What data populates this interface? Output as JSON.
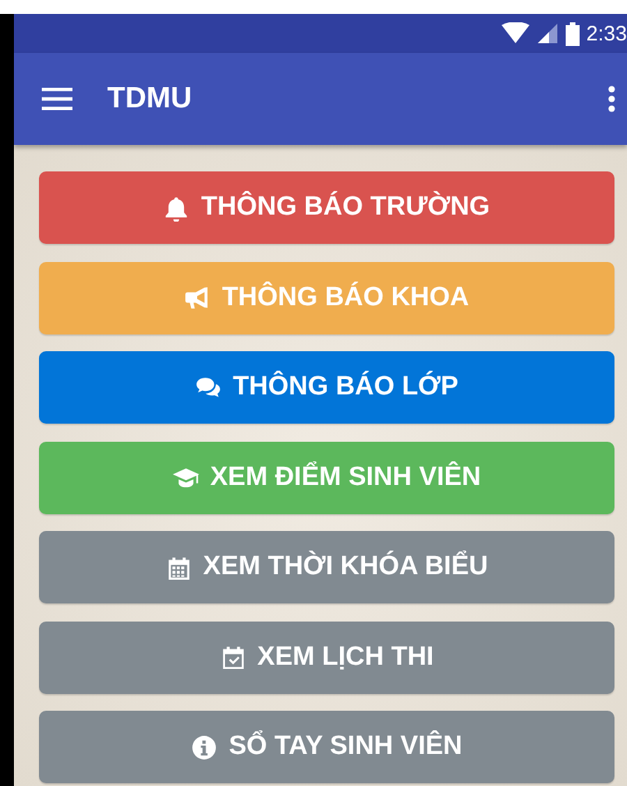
{
  "status_bar": {
    "time": "2:33"
  },
  "app_bar": {
    "title": "TDMU"
  },
  "buttons": [
    {
      "label": "THÔNG BÁO TRƯỜNG",
      "color": "#d9534f"
    },
    {
      "label": "THÔNG BÁO KHOA",
      "color": "#f0ad4e"
    },
    {
      "label": "THÔNG BÁO LỚP",
      "color": "#0275d8"
    },
    {
      "label": "XEM ĐIỂM SINH VIÊN",
      "color": "#5cb85c"
    },
    {
      "label": "XEM THỜI KHÓA BIỂU",
      "color": "#818a91"
    },
    {
      "label": "XEM LỊCH THI",
      "color": "#818a91"
    },
    {
      "label": "SỔ TAY SINH VIÊN",
      "color": "#818a91"
    }
  ]
}
